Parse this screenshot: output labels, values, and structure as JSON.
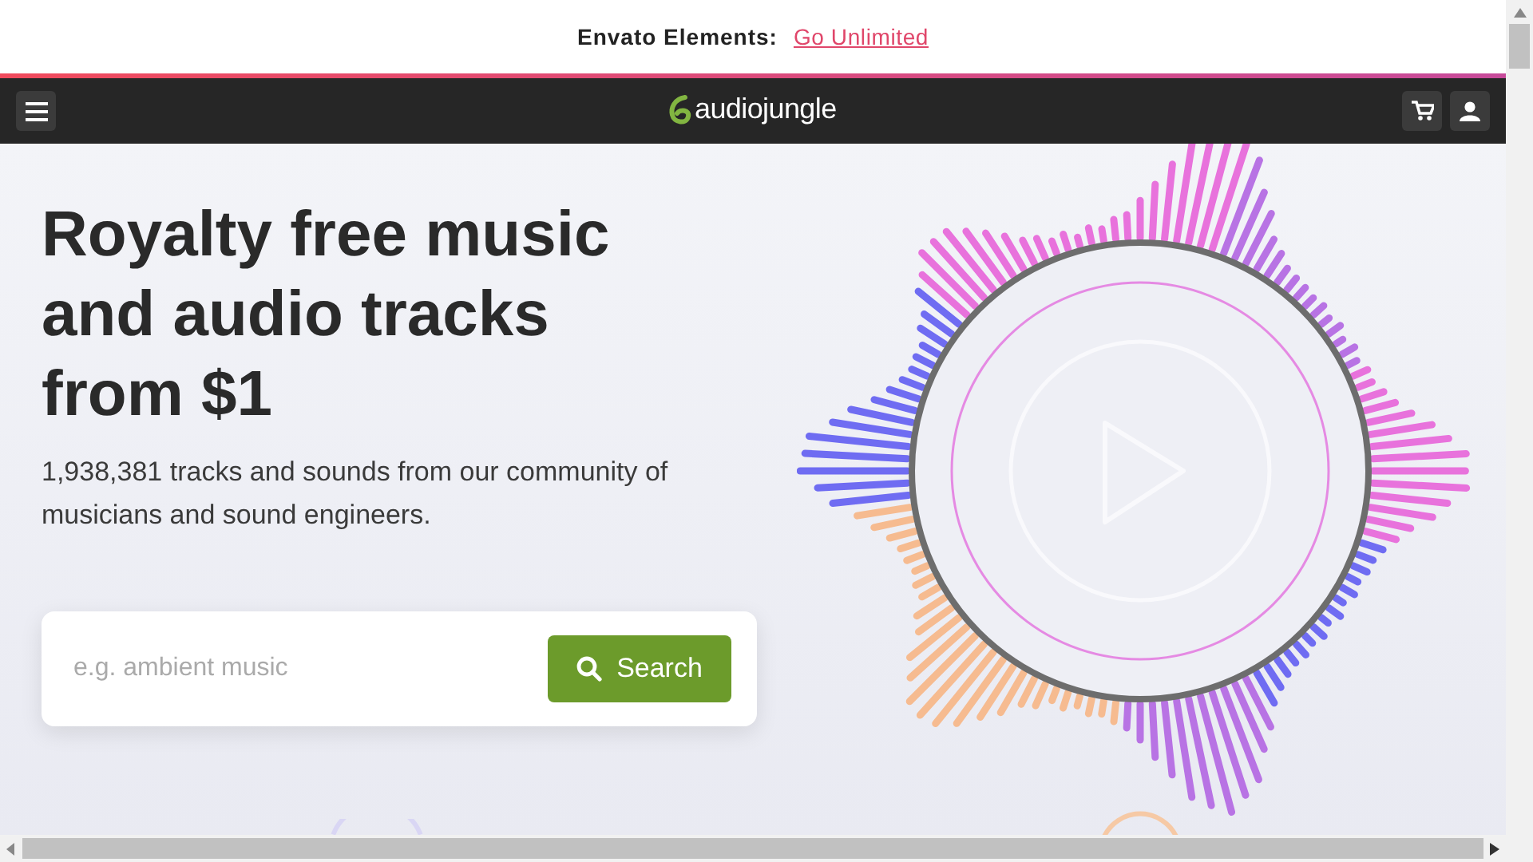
{
  "banner": {
    "label": "Envato Elements:",
    "link": "Go Unlimited"
  },
  "navbar": {
    "logo": "audiojungle"
  },
  "hero": {
    "title": "Royalty free music and audio tracks from $1",
    "subtitle": "1,938,381 tracks and sounds from our community of musicians and sound engineers.",
    "search": {
      "placeholder": "e.g. ambient music",
      "button": "Search"
    }
  }
}
